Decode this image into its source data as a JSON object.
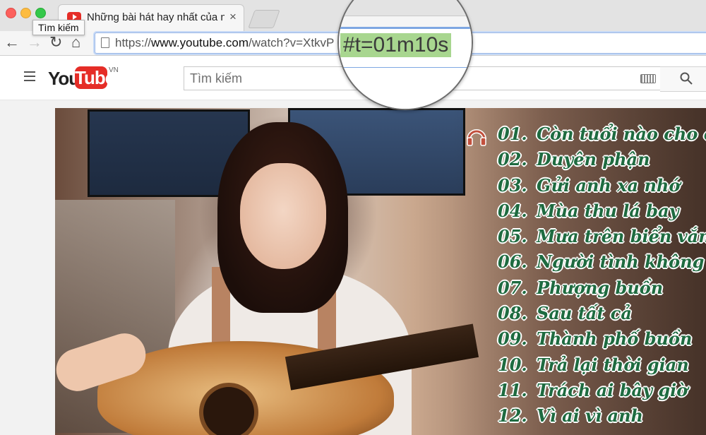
{
  "browser": {
    "tab_title": "Những bài hát hay nhất của nữ",
    "tab_close": "×",
    "tooltip": "Tìm kiếm",
    "url_prefix": "https://",
    "url_domain": "www.youtube.com",
    "url_path": "/watch?v=XtkvP",
    "nav": {
      "back": "←",
      "forward": "→",
      "reload": "↻",
      "home": "⌂"
    }
  },
  "magnifier": {
    "text": "#t=01m10s",
    "highlight_color": "#a8d68f"
  },
  "youtube": {
    "logo_you": "You",
    "logo_tube": "Tube",
    "logo_region": "VN",
    "search_placeholder": "Tìm kiếm",
    "brand_color": "#e52d27"
  },
  "video": {
    "playlist_color": "#1e6b40",
    "tracks": [
      {
        "num": "01.",
        "name": "Còn tuổi nào cho em"
      },
      {
        "num": "02.",
        "name": "Duyên phận"
      },
      {
        "num": "03.",
        "name": "Gửi anh xa nhớ"
      },
      {
        "num": "04.",
        "name": "Mùa thu lá bay"
      },
      {
        "num": "05.",
        "name": "Mưa trên biển vắng"
      },
      {
        "num": "06.",
        "name": "Người tình không đến"
      },
      {
        "num": "07.",
        "name": "Phượng buồn"
      },
      {
        "num": "08.",
        "name": "Sau tất cả"
      },
      {
        "num": "09.",
        "name": "Thành phố buồn"
      },
      {
        "num": "10.",
        "name": "Trả lại thời gian"
      },
      {
        "num": "11.",
        "name": "Trách ai bây giờ"
      },
      {
        "num": "12.",
        "name": "Vì ai vì anh"
      }
    ]
  }
}
